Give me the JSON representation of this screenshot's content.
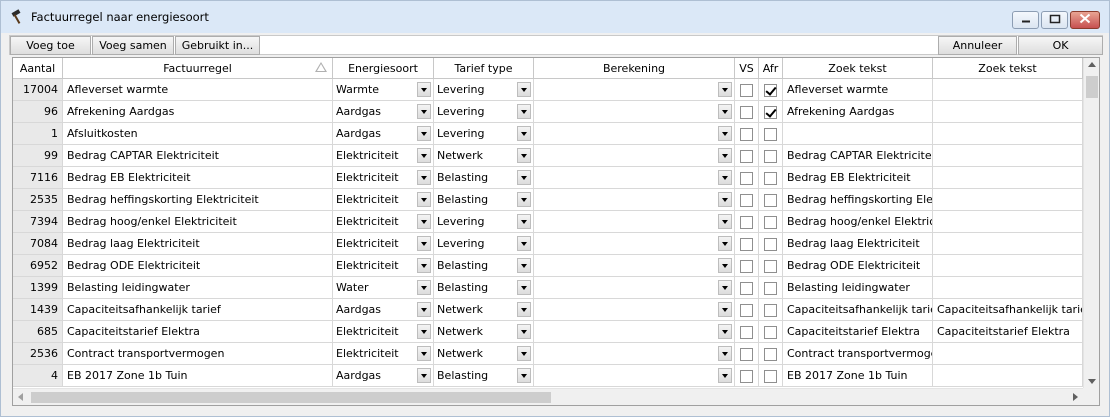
{
  "window": {
    "title": "Factuurregel naar energiesoort",
    "icon": "hammer-icon",
    "controls": [
      "minimize-icon",
      "maximize-icon",
      "close-icon"
    ]
  },
  "toolbar": {
    "voeg_toe": "Voeg toe",
    "voeg_samen": "Voeg samen",
    "gebruikt_in": "Gebruikt in...",
    "annuleer": "Annuleer",
    "ok": "OK"
  },
  "grid": {
    "headers": [
      "Aantal",
      "Factuurregel",
      "Energiesoort",
      "Tarief type",
      "Berekening",
      "VS",
      "Afr",
      "Zoek tekst",
      "Zoek tekst"
    ],
    "sorted_column": "Factuurregel",
    "rows": [
      {
        "aantal": "17004",
        "factuurregel": "Afleverset warmte",
        "energiesoort": "Warmte",
        "tarief": "Levering",
        "berekening": "",
        "vs": false,
        "afr": true,
        "zoek1": "Afleverset warmte",
        "zoek2": ""
      },
      {
        "aantal": "96",
        "factuurregel": "Afrekening Aardgas",
        "energiesoort": "Aardgas",
        "tarief": "Levering",
        "berekening": "",
        "vs": false,
        "afr": true,
        "zoek1": "Afrekening Aardgas",
        "zoek2": ""
      },
      {
        "aantal": "1",
        "factuurregel": "Afsluitkosten",
        "energiesoort": "Aardgas",
        "tarief": "Levering",
        "berekening": "",
        "vs": false,
        "afr": false,
        "zoek1": "",
        "zoek2": ""
      },
      {
        "aantal": "99",
        "factuurregel": "Bedrag CAPTAR Elektriciteit",
        "energiesoort": "Elektriciteit",
        "tarief": "Netwerk",
        "berekening": "",
        "vs": false,
        "afr": false,
        "zoek1": "Bedrag CAPTAR Elektriciteit",
        "zoek2": ""
      },
      {
        "aantal": "7116",
        "factuurregel": "Bedrag EB Elektriciteit",
        "energiesoort": "Elektriciteit",
        "tarief": "Belasting",
        "berekening": "",
        "vs": false,
        "afr": false,
        "zoek1": "Bedrag EB Elektriciteit",
        "zoek2": ""
      },
      {
        "aantal": "2535",
        "factuurregel": "Bedrag heffingskorting Elektriciteit",
        "energiesoort": "Elektriciteit",
        "tarief": "Belasting",
        "berekening": "",
        "vs": false,
        "afr": false,
        "zoek1": "Bedrag heffingskorting Elek",
        "zoek2": ""
      },
      {
        "aantal": "7394",
        "factuurregel": "Bedrag hoog/enkel Elektriciteit",
        "energiesoort": "Elektriciteit",
        "tarief": "Levering",
        "berekening": "",
        "vs": false,
        "afr": false,
        "zoek1": "Bedrag hoog/enkel Elektrici",
        "zoek2": ""
      },
      {
        "aantal": "7084",
        "factuurregel": "Bedrag laag Elektriciteit",
        "energiesoort": "Elektriciteit",
        "tarief": "Levering",
        "berekening": "",
        "vs": false,
        "afr": false,
        "zoek1": "Bedrag laag Elektriciteit",
        "zoek2": ""
      },
      {
        "aantal": "6952",
        "factuurregel": "Bedrag ODE Elektriciteit",
        "energiesoort": "Elektriciteit",
        "tarief": "Belasting",
        "berekening": "",
        "vs": false,
        "afr": false,
        "zoek1": "Bedrag ODE Elektriciteit",
        "zoek2": ""
      },
      {
        "aantal": "1399",
        "factuurregel": "Belasting leidingwater",
        "energiesoort": "Water",
        "tarief": "Belasting",
        "berekening": "",
        "vs": false,
        "afr": false,
        "zoek1": "Belasting leidingwater",
        "zoek2": ""
      },
      {
        "aantal": "1439",
        "factuurregel": "Capaciteitsafhankelijk tarief",
        "energiesoort": "Aardgas",
        "tarief": "Netwerk",
        "berekening": "",
        "vs": false,
        "afr": false,
        "zoek1": "Capaciteitsafhankelijk tarief",
        "zoek2": "Capaciteitsafhankelijk tarief"
      },
      {
        "aantal": "685",
        "factuurregel": "Capaciteitstarief Elektra",
        "energiesoort": "Elektriciteit",
        "tarief": "Netwerk",
        "berekening": "",
        "vs": false,
        "afr": false,
        "zoek1": "Capaciteitstarief Elektra",
        "zoek2": "Capaciteitstarief Elektra"
      },
      {
        "aantal": "2536",
        "factuurregel": "Contract transportvermogen",
        "energiesoort": "Elektriciteit",
        "tarief": "Netwerk",
        "berekening": "",
        "vs": false,
        "afr": false,
        "zoek1": "Contract transportvermoge",
        "zoek2": ""
      },
      {
        "aantal": "4",
        "factuurregel": "EB 2017 Zone 1b Tuin",
        "energiesoort": "Aardgas",
        "tarief": "Belasting",
        "berekening": "",
        "vs": false,
        "afr": false,
        "zoek1": "EB 2017 Zone 1b Tuin",
        "zoek2": ""
      }
    ]
  }
}
